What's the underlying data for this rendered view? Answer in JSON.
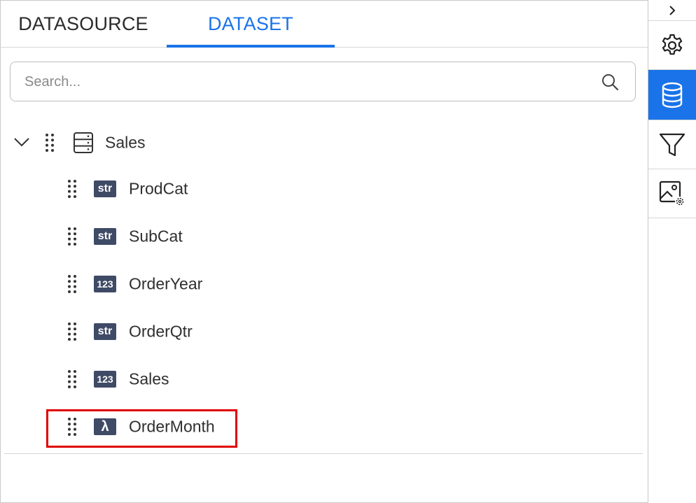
{
  "tabs": [
    {
      "label": "DATASOURCE",
      "active": false
    },
    {
      "label": "DATASET",
      "active": true
    }
  ],
  "search": {
    "placeholder": "Search..."
  },
  "tree": {
    "root": {
      "label": "Sales",
      "expanded": true,
      "icon": "table-icon"
    },
    "fields": [
      {
        "label": "ProdCat",
        "type": "str"
      },
      {
        "label": "SubCat",
        "type": "str"
      },
      {
        "label": "OrderYear",
        "type": "123"
      },
      {
        "label": "OrderQtr",
        "type": "str"
      },
      {
        "label": "Sales",
        "type": "123"
      },
      {
        "label": "OrderMonth",
        "type": "λ",
        "highlighted": true
      }
    ]
  },
  "sidebar": {
    "items": [
      {
        "icon": "chevron-right-icon"
      },
      {
        "icon": "gear-icon"
      },
      {
        "icon": "database-icon",
        "active": true
      },
      {
        "icon": "filter-icon"
      },
      {
        "icon": "image-settings-icon"
      }
    ]
  },
  "colors": {
    "accent": "#1a73e8",
    "badge": "#3f4a66",
    "highlight": "#e00000"
  }
}
